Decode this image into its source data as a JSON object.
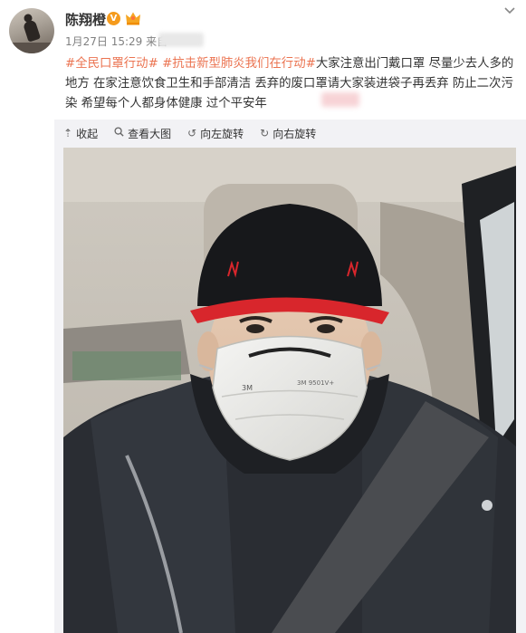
{
  "post": {
    "username": "陈翔橙",
    "verified_badge": "V",
    "time": "1月27日 15:29",
    "source_label": "来自",
    "text_segments": [
      {
        "type": "tag",
        "text": "#全民口罩行动#"
      },
      {
        "type": "plain",
        "text": " "
      },
      {
        "type": "tag",
        "text": "#抗击新型肺炎我们在行动#"
      },
      {
        "type": "plain",
        "text": "大家注意出门戴口罩 尽量少去人多的地方 在家注意饮食卫生和手部清洁 丢弃的废口罩请大家装进袋子再丢弃 防止二次污染 希望每个人都身体健康 过个平安年"
      }
    ],
    "toolbar": [
      {
        "icon": "collapse-icon",
        "glyph": "⇡",
        "label": "收起"
      },
      {
        "icon": "zoom-icon",
        "glyph": "🔍",
        "label": "查看大图"
      },
      {
        "icon": "rotate-left-icon",
        "glyph": "↺",
        "label": "向左旋转"
      },
      {
        "icon": "rotate-right-icon",
        "glyph": "↻",
        "label": "向右旋转"
      }
    ],
    "photo_mask_label": "3M 9501V+",
    "mask_brand": "3M"
  },
  "colors": {
    "tag": "#eb7350",
    "verified": "#f59b1d",
    "media_bg": "#f2f2f5"
  }
}
